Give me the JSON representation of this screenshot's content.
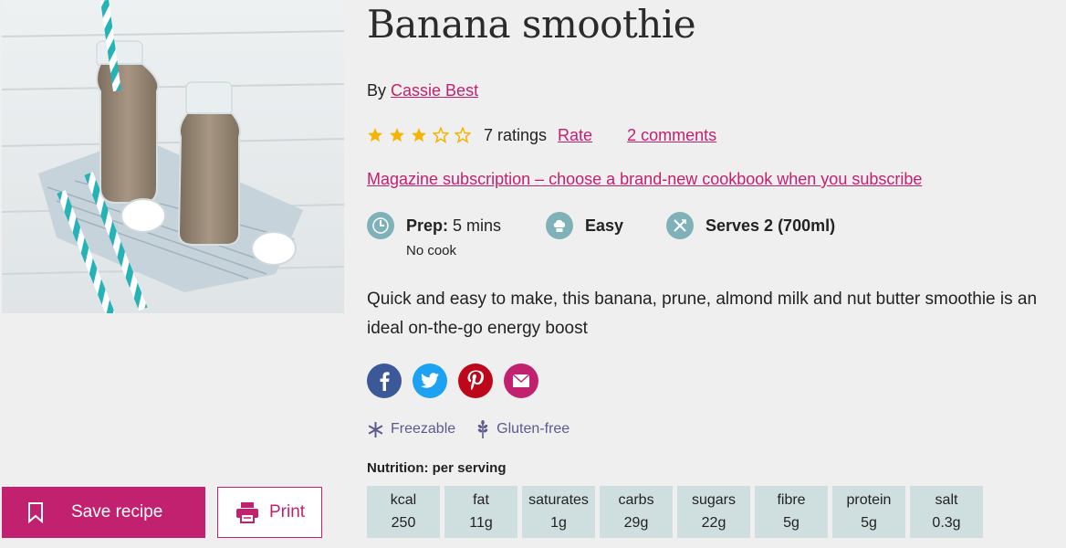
{
  "recipe": {
    "title": "Banana smoothie",
    "by_prefix": "By",
    "author": "Cassie Best",
    "rating": 3.5,
    "ratings_count": "7 ratings",
    "rate_label": "Rate",
    "comments_label": "2 comments",
    "promo_text": "Magazine subscription – choose a brand-new cookbook when you subscribe",
    "prep_label": "Prep:",
    "prep_value": "5 mins",
    "cook_note": "No cook",
    "difficulty": "Easy",
    "serves": "Serves 2 (700ml)",
    "description": "Quick and easy to make, this banana, prune, almond milk and nut butter smoothie is an ideal on-the-go energy boost"
  },
  "photo": {
    "alt": "Two bottles of banana smoothie with striped straws"
  },
  "actions": {
    "save_label": "Save recipe",
    "print_label": "Print"
  },
  "social": [
    {
      "name": "facebook",
      "color": "#3b5998"
    },
    {
      "name": "twitter",
      "color": "#1da1f2"
    },
    {
      "name": "pinterest",
      "color": "#bd081c"
    },
    {
      "name": "email",
      "color": "#c2216f"
    }
  ],
  "diet": {
    "freezable": "Freezable",
    "gluten_free": "Gluten-free"
  },
  "nutrition": {
    "title": "Nutrition: per serving",
    "items": [
      {
        "label": "kcal",
        "value": "250"
      },
      {
        "label": "fat",
        "value": "11g"
      },
      {
        "label": "saturates",
        "value": "1g"
      },
      {
        "label": "carbs",
        "value": "29g"
      },
      {
        "label": "sugars",
        "value": "22g"
      },
      {
        "label": "fibre",
        "value": "5g"
      },
      {
        "label": "protein",
        "value": "5g"
      },
      {
        "label": "salt",
        "value": "0.3g"
      }
    ]
  },
  "colors": {
    "accent": "#c2216f",
    "meta_icon": "#7fb1b8",
    "star": "#f5b400",
    "diet": "#5b5a8f",
    "nutrition_bg": "#cfdfe0"
  }
}
